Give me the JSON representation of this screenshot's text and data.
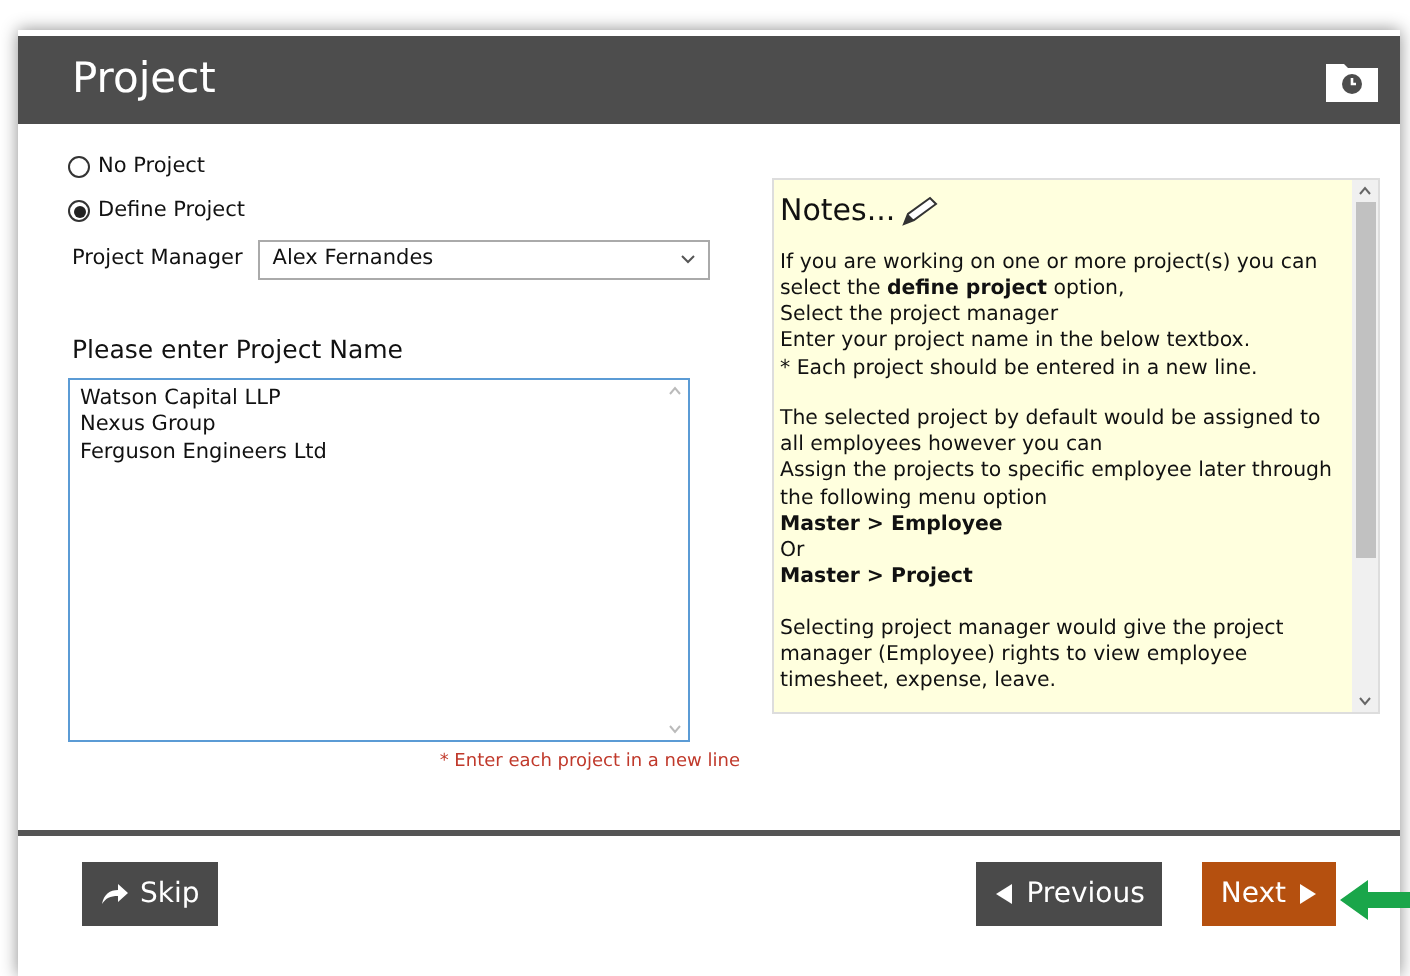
{
  "window": {
    "title": "Project"
  },
  "project_mode": [
    {
      "label": "No Project",
      "selected": false
    },
    {
      "label": "Define Project",
      "selected": true
    }
  ],
  "project_manager": {
    "label": "Project Manager",
    "value": "Alex Fernandes"
  },
  "project_names": {
    "label": "Please enter Project Name",
    "value": "Watson Capital LLP\nNexus Group\nFerguson Engineers Ltd",
    "hint": "* Enter each project in a new line"
  },
  "notes": {
    "title": "Notes...",
    "paragraphs": [
      [
        {
          "text": "If you are working on one or more project(s) you can select the **define project** option,",
          "bold": false
        },
        {
          "text": "Select the project manager",
          "bold": false
        },
        {
          "text": "Enter your project name in the below textbox.",
          "bold": false
        },
        {
          "text": "* Each project should be entered in a new line.",
          "bold": false
        }
      ],
      [
        {
          "text": "The selected project by default would be assigned to all employees however you can",
          "bold": false
        },
        {
          "text": "Assign the projects to specific employee later through the following menu option",
          "bold": false
        },
        {
          "text": "Master > Employee",
          "bold": true
        },
        {
          "text": "Or",
          "bold": false
        },
        {
          "text": "Master > Project",
          "bold": true
        }
      ],
      [
        {
          "text": "Selecting project manager would give the project manager (Employee) rights to view employee timesheet, expense, leave.",
          "bold": false
        }
      ]
    ]
  },
  "buttons": [
    {
      "label": "Skip",
      "kind": "skip"
    },
    {
      "label": "Previous",
      "kind": "previous"
    },
    {
      "label": "Next",
      "kind": "next"
    }
  ]
}
